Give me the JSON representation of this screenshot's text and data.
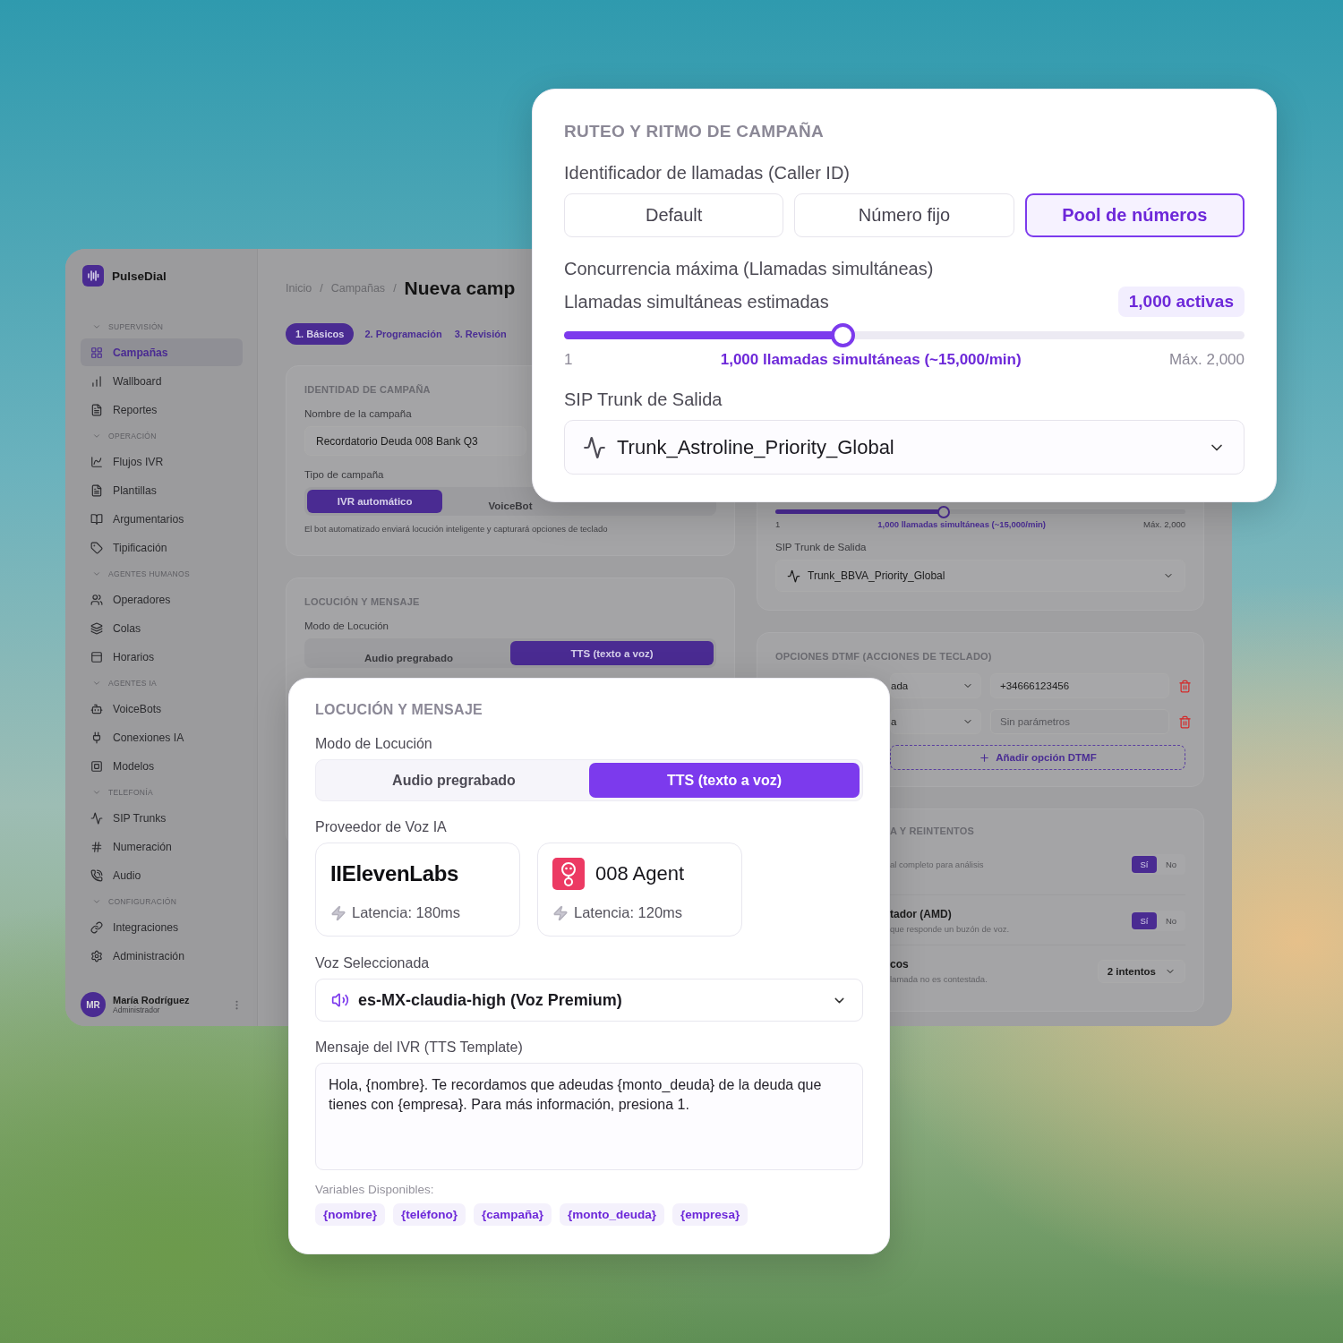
{
  "brand": {
    "name": "PulseDial"
  },
  "sidebar": {
    "sections": [
      {
        "title": "SUPERVISIÓN",
        "items": [
          {
            "label": "Campañas",
            "selected": true
          },
          {
            "label": "Wallboard",
            "selected": false
          },
          {
            "label": "Reportes",
            "selected": false
          }
        ]
      },
      {
        "title": "OPERACIÓN",
        "items": [
          {
            "label": "Flujos IVR",
            "selected": false
          },
          {
            "label": "Plantillas",
            "selected": false
          },
          {
            "label": "Argumentarios",
            "selected": false
          },
          {
            "label": "Tipificación",
            "selected": false
          }
        ]
      },
      {
        "title": "AGENTES HUMANOS",
        "items": [
          {
            "label": "Operadores",
            "selected": false
          },
          {
            "label": "Colas",
            "selected": false
          },
          {
            "label": "Horarios",
            "selected": false
          }
        ]
      },
      {
        "title": "AGENTES IA",
        "items": [
          {
            "label": "VoiceBots",
            "selected": false
          },
          {
            "label": "Conexiones IA",
            "selected": false
          },
          {
            "label": "Modelos",
            "selected": false
          }
        ]
      },
      {
        "title": "TELEFONÍA",
        "items": [
          {
            "label": "SIP Trunks",
            "selected": false
          },
          {
            "label": "Numeración",
            "selected": false
          },
          {
            "label": "Audio",
            "selected": false
          }
        ]
      },
      {
        "title": "CONFIGURACIÓN",
        "items": [
          {
            "label": "Integraciones",
            "selected": false
          },
          {
            "label": "Administración",
            "selected": false
          }
        ]
      }
    ]
  },
  "user": {
    "initials": "MR",
    "name": "María Rodríguez",
    "role": "Administrador"
  },
  "breadcrumb": {
    "items": [
      "Inicio",
      "Campañas"
    ],
    "separator": "/",
    "title": "Nueva camp"
  },
  "steps": [
    {
      "label": "1. Básicos",
      "selected": true
    },
    {
      "label": "2. Programación",
      "selected": false
    },
    {
      "label": "3. Revisión",
      "selected": false
    }
  ],
  "identity_card": {
    "title": "IDENTIDAD DE CAMPAÑA",
    "name_label": "Nombre de la campaña",
    "name_value": "Recordatorio Deuda 008 Bank Q3",
    "type_label": "Tipo de campaña",
    "type_options": [
      {
        "label": "IVR automático",
        "selected": true
      },
      {
        "label": "VoiceBot",
        "selected": false
      }
    ],
    "hint": "El bot automatizado enviará locución inteligente y capturará opciones de teclado"
  },
  "background_locution": {
    "title": "LOCUCIÓN Y MENSAJE",
    "mode_label": "Modo de Locución",
    "modes": [
      {
        "label": "Audio pregrabado",
        "selected": false
      },
      {
        "label": "TTS (texto a voz)",
        "selected": true
      }
    ]
  },
  "background_routing": {
    "slider": {
      "level": 0.41,
      "min": "1",
      "reading": "1,000 llamadas simultáneas (~15,000/min)",
      "max": "Máx. 2,000"
    },
    "trunk_label": "SIP Trunk de Salida",
    "trunk_value": "Trunk_BBVA_Priority_Global"
  },
  "dtmf": {
    "title": "OPCIONES DTMF (ACCIONES DE TECLADO)",
    "rows": [
      {
        "action": "ada",
        "value": "+34666123456"
      },
      {
        "action": "a",
        "placeholder": "Sin parámetros"
      }
    ],
    "add_label": "Añadir opción DTMF"
  },
  "retries": {
    "title": "A Y REINTENTOS",
    "rows": [
      {
        "kind": "toggle",
        "description": "al completo para análisis",
        "options": [
          {
            "label": "Sí",
            "selected": true
          },
          {
            "label": "No",
            "selected": false
          }
        ]
      },
      {
        "kind": "toggle",
        "title": "tador (AMD)",
        "description": "que responde un buzón de voz.",
        "options": [
          {
            "label": "Sí",
            "selected": true
          },
          {
            "label": "No",
            "selected": false
          }
        ]
      },
      {
        "kind": "select",
        "title": "cos",
        "description": "lamada no es contestada.",
        "value": "2 intentos"
      }
    ]
  },
  "routing_card": {
    "title": "RUTEO Y RITMO DE CAMPAÑA",
    "caller_id_label": "Identificador de llamadas (Caller ID)",
    "caller_id_options": [
      {
        "label": "Default",
        "selected": false
      },
      {
        "label": "Número fijo",
        "selected": false
      },
      {
        "label": "Pool de números",
        "selected": true
      }
    ],
    "concurrency_label": "Concurrencia máxima (Llamadas simultáneas)",
    "estimate_label": "Llamadas simultáneas estimadas",
    "estimate_badge": "1,000 activas",
    "slider": {
      "level": 0.41,
      "min": "1",
      "reading": "1,000 llamadas simultáneas (~15,000/min)",
      "max": "Máx. 2,000"
    },
    "trunk_label": "SIP Trunk de Salida",
    "trunk_value": "Trunk_Astroline_Priority_Global"
  },
  "voice_card": {
    "title": "LOCUCIÓN Y MENSAJE",
    "mode_label": "Modo de Locución",
    "modes": [
      {
        "label": "Audio pregrabado",
        "selected": false
      },
      {
        "label": "TTS (texto a voz)",
        "selected": true
      }
    ],
    "provider_label": "Proveedor de Voz IA",
    "providers": [
      {
        "kind": "wordmark",
        "name": "IIElevenLabs",
        "latency": "Latencia: 180ms"
      },
      {
        "kind": "logo",
        "name": "008 Agent",
        "latency": "Latencia: 120ms"
      }
    ],
    "voice_label": "Voz Seleccionada",
    "voice_value": "es-MX-claudia-high (Voz Premium)",
    "message_label": "Mensaje del IVR (TTS Template)",
    "message_value": "Hola, {nombre}. Te recordamos que adeudas {monto_deuda} de la deuda que tienes con {empresa}. Para más información, presiona 1.",
    "variables_label": "Variables Disponibles:",
    "variables": [
      "{nombre}",
      "{teléfono}",
      "{campaña}",
      "{monto_deuda}",
      "{empresa}"
    ]
  }
}
